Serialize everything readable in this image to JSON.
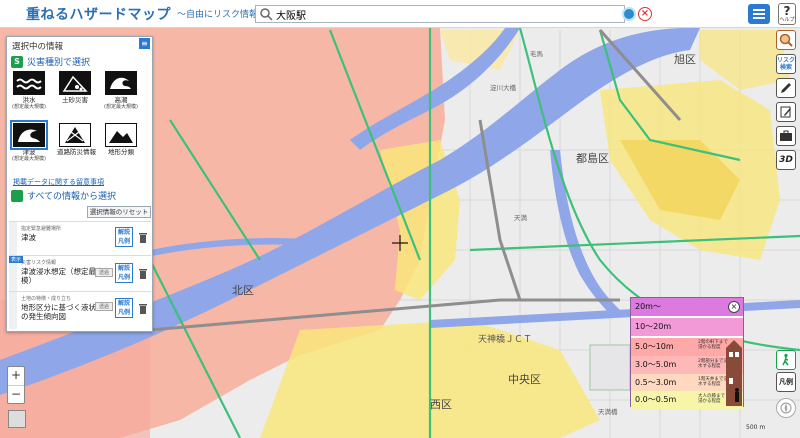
{
  "header": {
    "logo": "重ねるハザードマップ",
    "tagline": "～自由にリスク情報を調べる～",
    "search_value": "大阪駅",
    "help_label": "?",
    "help_sub": "ヘルプ"
  },
  "panel": {
    "title": "選択中の情報",
    "hazard_heading": "災害種別で選択",
    "hazards": [
      {
        "label": "洪水",
        "sub": "(想定最大規模)"
      },
      {
        "label": "土砂災害",
        "sub": ""
      },
      {
        "label": "高潮",
        "sub": "(想定最大規模)"
      },
      {
        "label": "津波",
        "sub": "(想定最大規模)"
      },
      {
        "label": "道路防災情報",
        "sub": ""
      },
      {
        "label": "地形分類",
        "sub": ""
      }
    ],
    "notes_link": "掲載データに関する留意事項",
    "all_info": "すべての情報から選択",
    "reset": "選択情報のリセット",
    "layers": [
      {
        "caption": "指定緊急避難場所",
        "name": "津波",
        "legend": "解説\n凡例"
      },
      {
        "badge": "表示",
        "caption": "災害リスク情報",
        "name": "津波浸水想定（想定最大規模）",
        "opacity": "透過",
        "legend": "解説\n凡例"
      },
      {
        "caption": "土地の特徴・成り立ち",
        "name": "地形区分に基づく液状化の発生傾向図",
        "opacity": "透過",
        "legend": "解説\n凡例"
      }
    ]
  },
  "map_labels": {
    "asahi": "旭区",
    "miyakojima": "都島区",
    "chuo": "中央区",
    "kita": "北区",
    "nishi": "西区",
    "jct": "天神橋ＪＣＴ",
    "yodogawa_ohashi": "淀川大橋",
    "kema": "毛馬",
    "kotobuki": "天満",
    "tenma": "天満橋"
  },
  "legend": {
    "rows": [
      "20m～",
      "10～20m",
      "5.0～10m",
      "3.0～5.0m",
      "0.5～3.0m",
      "0.0～0.5m"
    ],
    "notes": [
      "2階の軒下まで浸かる程度",
      "2階部分まで浸水する程度",
      "1階天井まで浸水する程度",
      "大人の膝まで浸かる程度"
    ],
    "colors": [
      "#dc7ae0",
      "#f29ad8",
      "#ffa8a8",
      "#ffb8b8",
      "#ffd8c0",
      "#f7f5a8"
    ]
  },
  "toolbar": {
    "risk_label": "リスク検索",
    "threed": "3D",
    "legend_label": "凡例"
  },
  "zoom": {
    "plus": "+",
    "minus": "−"
  },
  "scale": "500 m"
}
